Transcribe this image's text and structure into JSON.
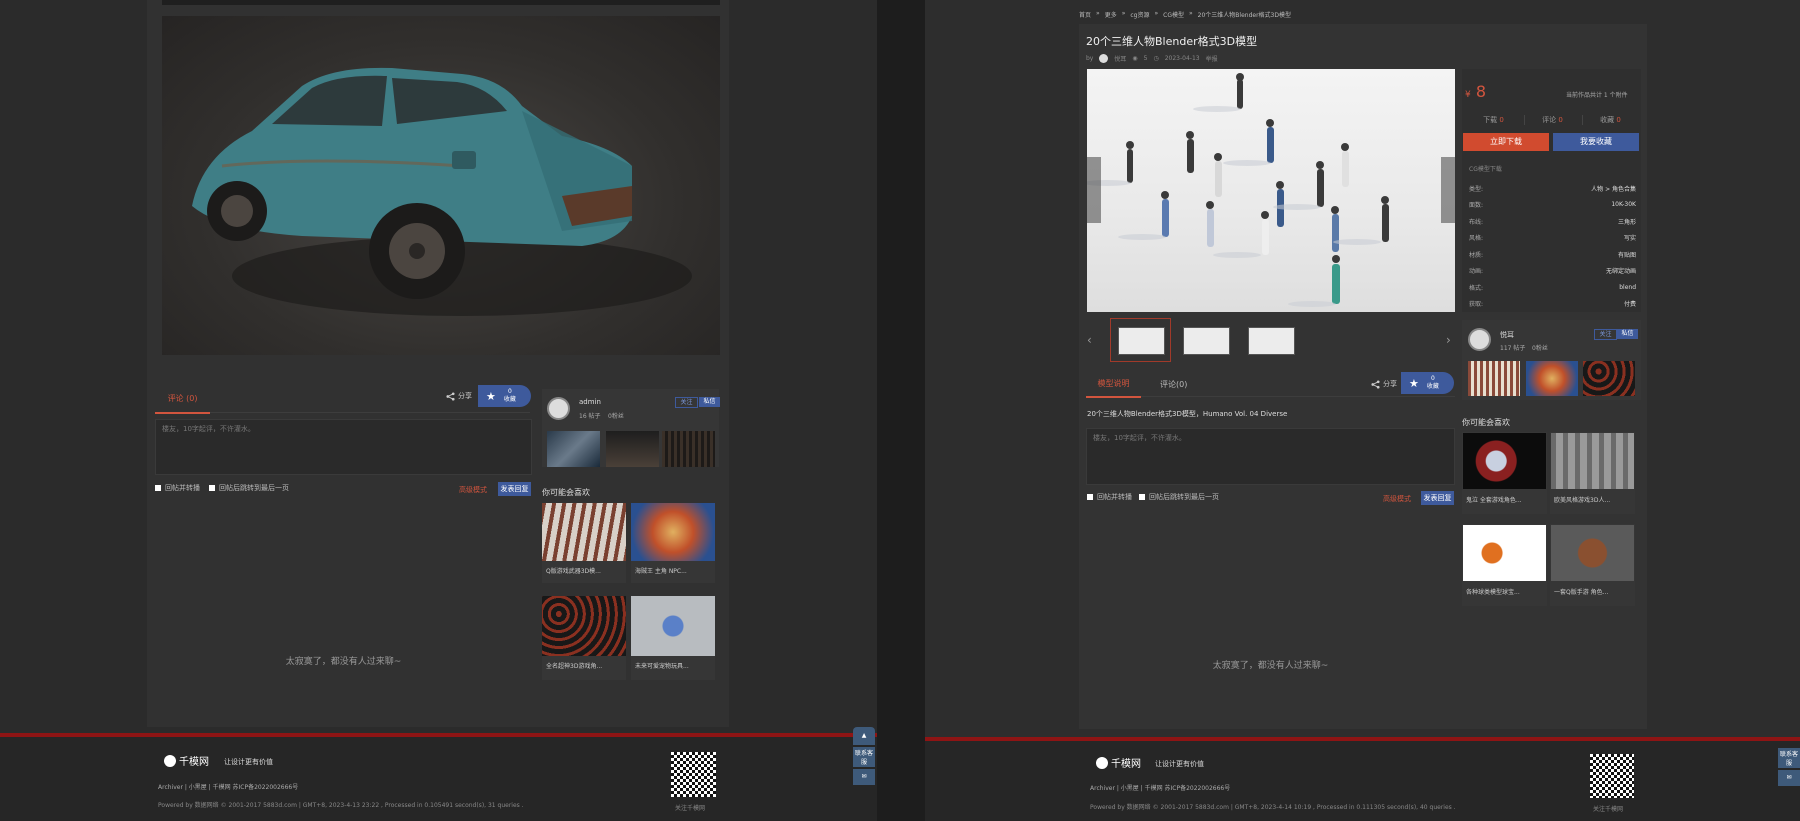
{
  "left": {
    "tabs": [
      {
        "label": "评论 (0)"
      }
    ],
    "share_label": "分享",
    "fav": {
      "count": "0",
      "label": "收藏"
    },
    "comment_placeholder": "楼友，10字起评，不许灌水。",
    "checkbox_1": "回帖并转播",
    "checkbox_2": "回帖后跳转到最后一页",
    "advanced_link": "高级模式",
    "submit_label": "发表回复",
    "author": {
      "name": "admin",
      "posts": "16 帖子",
      "fans": "0粉丝",
      "follow": "关注",
      "message": "私信"
    },
    "recommend_title": "你可能会喜欢",
    "recommend": [
      {
        "caption": "Q版游戏武器3D模..."
      },
      {
        "caption": "海贼王 主角 NPC..."
      },
      {
        "caption": "全名超神3D游戏角..."
      },
      {
        "caption": "未来可爱宠物玩具..."
      }
    ],
    "empty_text": "太寂寞了，都没有人过来聊~"
  },
  "right": {
    "breadcrumb": [
      "首页",
      "更多",
      "cg资源",
      "CG模型",
      "20个三维人物Blender格式3D模型"
    ],
    "title": "20个三维人物Blender格式3D模型",
    "meta": {
      "by": "by",
      "author": "悦耳",
      "views": "5",
      "date": "2023-04-13",
      "extra": "举报"
    },
    "price": "8",
    "currency": "¥",
    "works_info": "当前作品共计 1 个附件",
    "stats": [
      {
        "label": "下载",
        "value": "0"
      },
      {
        "label": "评论",
        "value": "0"
      },
      {
        "label": "收藏",
        "value": "0"
      }
    ],
    "download_btn": "立即下载",
    "fav_btn": "我要收藏",
    "section_label": "CG模型下载",
    "specs": [
      {
        "k": "类型:",
        "v": "人物 > 角色合集"
      },
      {
        "k": "面数:",
        "v": "10K-30K"
      },
      {
        "k": "布线:",
        "v": "三角形"
      },
      {
        "k": "风格:",
        "v": "写实"
      },
      {
        "k": "材质:",
        "v": "有贴图"
      },
      {
        "k": "动画:",
        "v": "无绑定动画"
      },
      {
        "k": "格式:",
        "v": "blend"
      },
      {
        "k": "获取:",
        "v": "付费"
      }
    ],
    "author": {
      "name": "悦耳",
      "posts": "117 帖子",
      "fans": "0粉丝",
      "follow": "关注",
      "message": "私信"
    },
    "tabs": [
      {
        "label": "模型说明"
      },
      {
        "label": "评论(0)"
      }
    ],
    "share_label": "分享",
    "fav": {
      "count": "0",
      "label": "收藏"
    },
    "description": "20个三维人物Blender格式3D模型，Humano Vol. 04 Diverse",
    "comment_placeholder": "楼友，10字起评，不许灌水。",
    "checkbox_1": "回帖并转播",
    "checkbox_2": "回帖后跳转到最后一页",
    "advanced_link": "高级模式",
    "submit_label": "发表回复",
    "recommend_title": "你可能会喜欢",
    "recommend": [
      {
        "caption": "鬼泣 全套游戏角色..."
      },
      {
        "caption": "欧美风格游戏3D人..."
      },
      {
        "caption": "各种球类模型球宝..."
      },
      {
        "caption": "一套Q版手游 角色..."
      }
    ],
    "empty_text": "太寂寞了，都没有人过来聊~"
  },
  "footer_left": {
    "logo": "千模网",
    "slogan": "让设计更有价值",
    "links": "Archiver |  小黑屋 |  千模网  苏ICP备2022002666号",
    "powered": "Powered by 数据网络  © 2001-2017 5883d.com  |  GMT+8, 2023-4-13 23:22 , Processed in 0.105491 second(s), 31 queries .",
    "qr_caption": "关注千模网"
  },
  "footer_right": {
    "logo": "千模网",
    "slogan": "让设计更有价值",
    "links": "Archiver |  小黑屋 |  千模网  苏ICP备2022002666号",
    "powered": "Powered by 数据网络  © 2001-2017 5883d.com  |  GMT+8, 2023-4-14 10:19 , Processed in 0.111305 second(s), 40 queries .",
    "qr_caption": "关注千模网"
  },
  "float": {
    "service": "联系客服"
  }
}
